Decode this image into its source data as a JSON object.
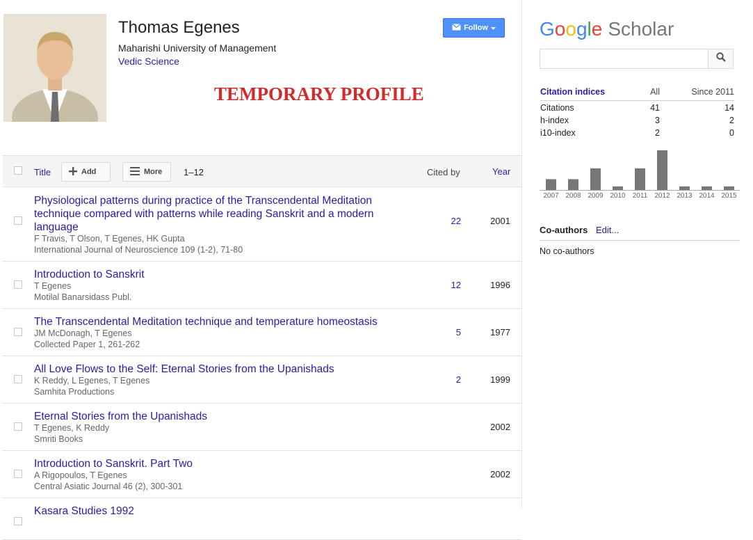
{
  "profile": {
    "name": "Thomas Egenes",
    "affiliation": "Maharishi University of Management",
    "interest": "Vedic Science",
    "banner": "TEMPORARY PROFILE",
    "follow_label": "Follow"
  },
  "table": {
    "title_header": "Title",
    "add_label": "Add",
    "more_label": "More",
    "range": "1–12",
    "cited_header": "Cited by",
    "year_header": "Year",
    "rows": [
      {
        "title": "Physiological patterns during practice of the Transcendental Meditation technique compared with patterns while reading Sanskrit and a modern language",
        "authors": "F Travis, T Olson, T Egenes, HK Gupta",
        "venue": "International Journal of Neuroscience 109 (1-2), 71-80",
        "cited": "22",
        "year": "2001"
      },
      {
        "title": "Introduction to Sanskrit",
        "authors": "T Egenes",
        "venue": "Motilal Banarsidass Publ.",
        "cited": "12",
        "year": "1996"
      },
      {
        "title": "The Transcendental Meditation technique and temperature homeostasis",
        "authors": "JM McDonagh, T Egenes",
        "venue": "Collected Paper 1, 261-262",
        "cited": "5",
        "year": "1977"
      },
      {
        "title": "All Love Flows to the Self: Eternal Stories from the Upanishads",
        "authors": "K Reddy, L Egenes, T Egenes",
        "venue": "Samhita Productions",
        "cited": "2",
        "year": "1999"
      },
      {
        "title": "Eternal Stories from the Upanishads",
        "authors": "T Egenes, K Reddy",
        "venue": "Smriti Books",
        "cited": "",
        "year": "2002"
      },
      {
        "title": "Introduction to Sanskrit. Part Two",
        "authors": "A Rigopoulos, T Egenes",
        "venue": "Central Asiatic Journal 46 (2), 300-301",
        "cited": "",
        "year": "2002"
      },
      {
        "title": "Kasara Studies 1992",
        "authors": "",
        "venue": "",
        "cited": "",
        "year": ""
      }
    ]
  },
  "scholar": {
    "logo_letters": [
      "G",
      "o",
      "o",
      "g",
      "l",
      "e"
    ],
    "logo_word": "Scholar",
    "search_placeholder": ""
  },
  "citations": {
    "header": "Citation indices",
    "col_all": "All",
    "col_since": "Since 2011",
    "rows": [
      {
        "label": "Citations",
        "all": "41",
        "since": "14"
      },
      {
        "label": "h-index",
        "all": "3",
        "since": "2"
      },
      {
        "label": "i10-index",
        "all": "2",
        "since": "0"
      }
    ]
  },
  "chart_data": {
    "type": "bar",
    "categories": [
      "2007",
      "2008",
      "2009",
      "2010",
      "2011",
      "2012",
      "2013",
      "2014",
      "2015"
    ],
    "values": [
      3,
      3,
      6,
      1,
      6,
      11,
      1,
      1,
      1
    ],
    "ylim": [
      0,
      11
    ],
    "bar_color": "#777777"
  },
  "coauthors": {
    "title": "Co-authors",
    "edit_label": "Edit...",
    "empty_text": "No co-authors"
  }
}
